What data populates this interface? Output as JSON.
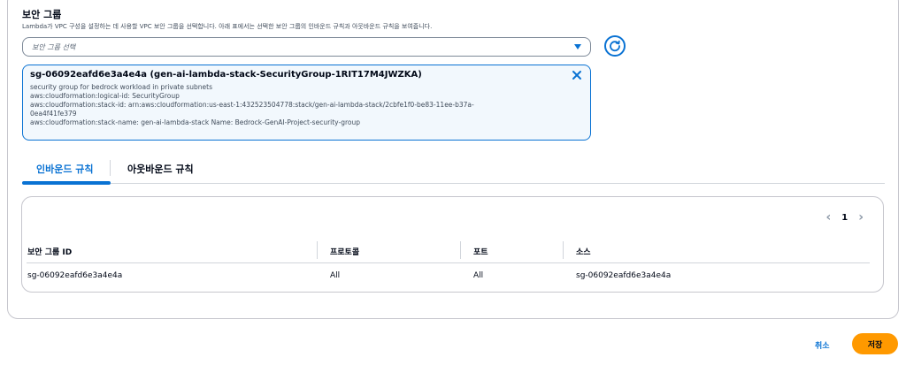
{
  "section": {
    "title": "보안 그룹",
    "description": "Lambda가 VPC 구성을 설정하는 데 사용할 VPC 보안 그룹을 선택합니다. 아래 표에서는 선택한 보안 그룹의 인바운드 규칙과 아웃바운드 규칙을 보여줍니다."
  },
  "select": {
    "placeholder": "보안 그룹 선택",
    "icon": "caret-down-icon"
  },
  "selected_token": {
    "name": "sg-06092eafd6e3a4e4a (gen-ai-lambda-stack-SecurityGroup-1RIT17M4JWZKA)",
    "lines": [
      "security group for bedrock workload in private subnets",
      "aws:cloudformation:logical-id: SecurityGroup",
      "aws:cloudformation:stack-id: arn:aws:cloudformation:us-east-1:432523504778:stack/gen-ai-lambda-stack/2cbfe1f0-be83-11ee-b37a-",
      "0ea4f41fe379",
      "aws:cloudformation:stack-name: gen-ai-lambda-stack     Name: Bedrock-GenAI-Project-security-group"
    ]
  },
  "tabs": [
    {
      "label": "인바운드 규칙",
      "active": true
    },
    {
      "label": "아웃바운드 규칙",
      "active": false
    }
  ],
  "pagination": {
    "current_page": "1"
  },
  "table": {
    "headers": [
      "보안 그룹 ID",
      "프로토콜",
      "포트",
      "소스"
    ],
    "rows": [
      [
        "sg-06092eafd6e3a4e4a",
        "All",
        "All",
        "sg-06092eafd6e3a4e4a"
      ]
    ]
  },
  "footer": {
    "cancel_label": "취소",
    "save_label": "저장"
  },
  "colors": {
    "accent": "#0972d3",
    "primary_button": "#ff9900",
    "token_bg": "#f2f8fd"
  }
}
